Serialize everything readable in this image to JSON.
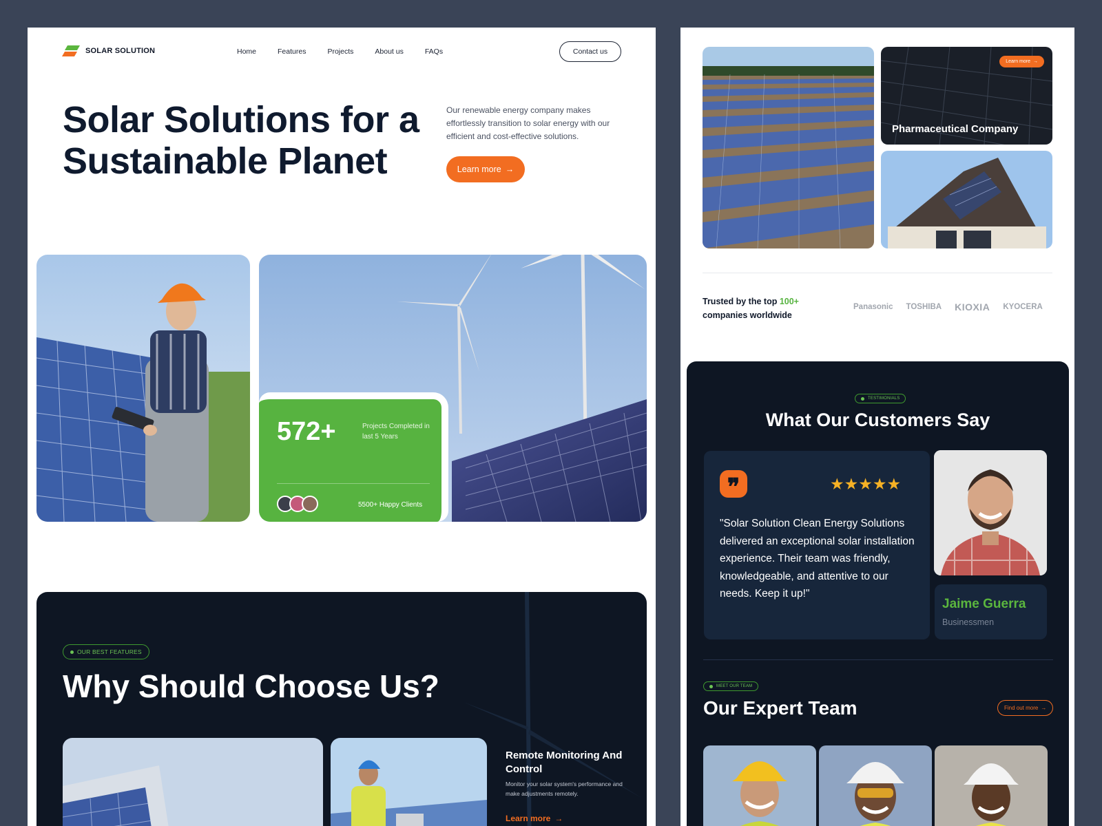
{
  "brand": {
    "name": "SOLAR SOLUTION"
  },
  "nav": {
    "links": [
      "Home",
      "Features",
      "Projects",
      "About us",
      "FAQs"
    ],
    "contact_label": "Contact us"
  },
  "hero": {
    "title": "Solar Solutions for a Sustainable Planet",
    "description": "Our renewable energy company makes effortlessly transition to solar energy with our efficient and cost-effective solutions.",
    "cta_label": "Learn more",
    "cta_icon": "arrow-right-icon"
  },
  "stats": {
    "number": "572+",
    "label": "Projects Completed in last 5 Years",
    "clients": "5500+ Happy Clients"
  },
  "features": {
    "pill": "OUR BEST FEATURES",
    "title": "Why Should Choose Us?",
    "item_title": "Remote Monitoring And Control",
    "item_desc": "Monitor your solar system's performance and make adjustments remotely.",
    "item_link": "Learn more"
  },
  "projects": {
    "mini_button": "Learn more",
    "pharma_label": "Pharmaceutical Company"
  },
  "trusted": {
    "text_prefix": "Trusted by the top",
    "highlight": "100+",
    "text_suffix": "companies worldwide",
    "brands": [
      "Panasonic",
      "TOSHIBA",
      "KIOXIA",
      "KYOCERA"
    ]
  },
  "testimonials": {
    "pill": "TESTIMONIALS",
    "title": "What Our Customers Say",
    "stars": "★★★★★",
    "quote": "\"Solar Solution Clean Energy Solutions delivered an exceptional solar installation experience. Their team was friendly, knowledgeable, and attentive to our needs. Keep it up!\"",
    "name": "Jaime Guerra",
    "role": "Businessmen"
  },
  "team": {
    "pill": "MEET OUR TEAM",
    "title": "Our Expert Team",
    "find_label": "Find out more"
  },
  "colors": {
    "orange": "#f26d21",
    "green": "#57b340",
    "navy": "#0e1623",
    "background": "#3a4457"
  }
}
